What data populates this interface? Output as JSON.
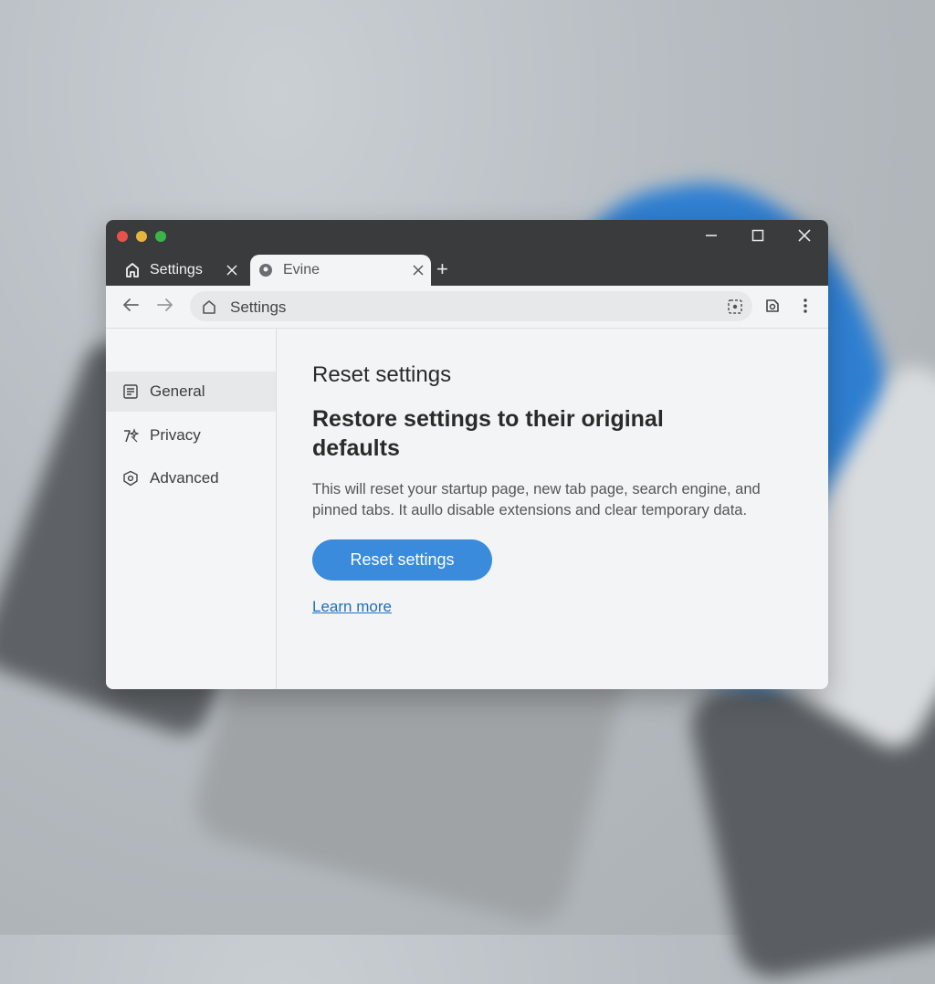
{
  "window": {
    "tabs": [
      {
        "title": "Settings",
        "icon": "home-icon",
        "active": false
      },
      {
        "title": "Evine",
        "icon": "globe-icon",
        "active": true
      }
    ],
    "new_tab_symbol": "+"
  },
  "toolbar": {
    "omnibox_text": "Settings"
  },
  "sidebar": {
    "items": [
      {
        "label": "General",
        "icon": "list-icon",
        "selected": true
      },
      {
        "label": "Privacy",
        "icon": "privacy-icon",
        "selected": false
      },
      {
        "label": "Advanced",
        "icon": "shield-icon",
        "selected": false
      }
    ]
  },
  "main": {
    "heading": "Reset settings",
    "subheading": "Restore settings to their original defaults",
    "description": "This will reset your startup page, new tab page, search engine, and pinned tabs. It aullo disable extensions and clear temporary data.",
    "reset_button_label": "Reset settings",
    "learn_more_label": "Learn more"
  },
  "colors": {
    "accent": "#3a8bdb",
    "link": "#1f6fc0",
    "titlebar": "#3a3b3d",
    "traffic_red": "#e5534b",
    "traffic_yellow": "#e8b43a",
    "traffic_green": "#3bb54a"
  }
}
